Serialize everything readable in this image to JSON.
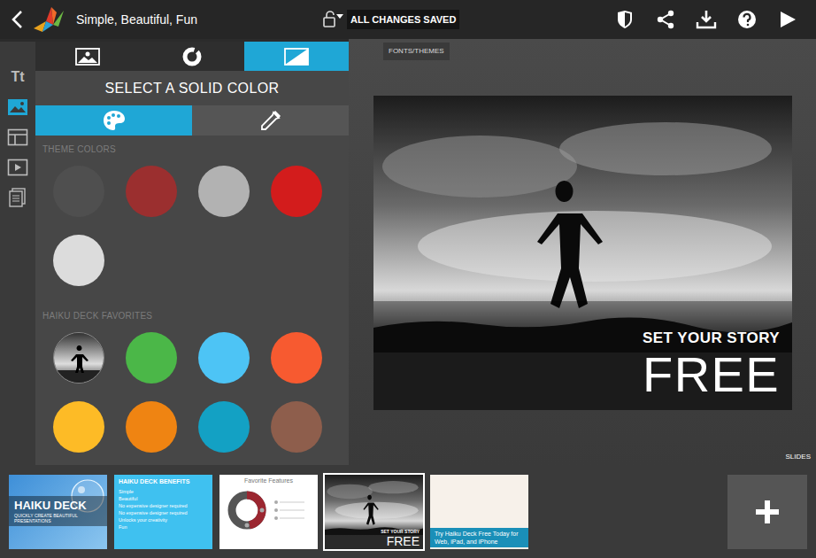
{
  "header": {
    "title": "Simple, Beautiful, Fun",
    "status": "ALL CHANGES SAVED"
  },
  "tooltip": "FONTS/THEMES",
  "rail": [
    {
      "kind": "text",
      "label": "Tt",
      "selected": false
    },
    {
      "kind": "image",
      "selected": true
    },
    {
      "kind": "layout",
      "selected": false
    },
    {
      "kind": "video",
      "selected": false
    },
    {
      "kind": "notes",
      "selected": false
    }
  ],
  "panel": {
    "tabs": [
      {
        "kind": "image",
        "selected": false
      },
      {
        "kind": "chart",
        "selected": false
      },
      {
        "kind": "solid",
        "selected": true
      }
    ],
    "heading": "SELECT A SOLID COLOR",
    "modes": [
      {
        "kind": "palette",
        "selected": true
      },
      {
        "kind": "eyedropper",
        "selected": false
      }
    ],
    "theme_label": "THEME COLORS",
    "theme_colors": [
      {
        "color": "#4f4f4f"
      },
      {
        "color": "#9b2f2f"
      },
      {
        "color": "#b2b2b2"
      },
      {
        "color": "#d31c1c"
      },
      {
        "color": "#dcdcdc"
      }
    ],
    "favorites_label": "HAIKU DECK FAVORITES",
    "favorites": [
      {
        "kind": "image"
      },
      {
        "kind": "color",
        "color": "#4bb748"
      },
      {
        "kind": "color",
        "color": "#4dc4f5"
      },
      {
        "kind": "color",
        "color": "#f75a30"
      },
      {
        "kind": "color",
        "color": "#fdbb26"
      },
      {
        "kind": "color",
        "color": "#ef8412"
      },
      {
        "kind": "color",
        "color": "#13a1c4"
      },
      {
        "kind": "color",
        "color": "#8e5e4c"
      }
    ]
  },
  "slide": {
    "subtitle": "SET YOUR STORY",
    "title": "FREE"
  },
  "slides_label": "SLIDES",
  "slides": [
    {
      "kind": "title",
      "selected": false,
      "title": "HAIKU DECK",
      "subtitle": "QUICKLY CREATE BEAUTIFUL PRESENTATIONS"
    },
    {
      "kind": "list",
      "selected": false,
      "title": "HAIKU DECK BENEFITS",
      "items": [
        "Simple",
        "Beautiful",
        "No expensive designer required",
        "No expensive designer required",
        "Unlocks your creativity",
        "Fun"
      ]
    },
    {
      "kind": "chart",
      "selected": false,
      "title": "Favorite Features"
    },
    {
      "kind": "photo",
      "selected": true,
      "subtitle": "SET YOUR STORY",
      "title": "FREE"
    },
    {
      "kind": "cta",
      "selected": false,
      "title": "Try Haiku Deck Free Today for Web, iPad, and iPhone"
    }
  ]
}
